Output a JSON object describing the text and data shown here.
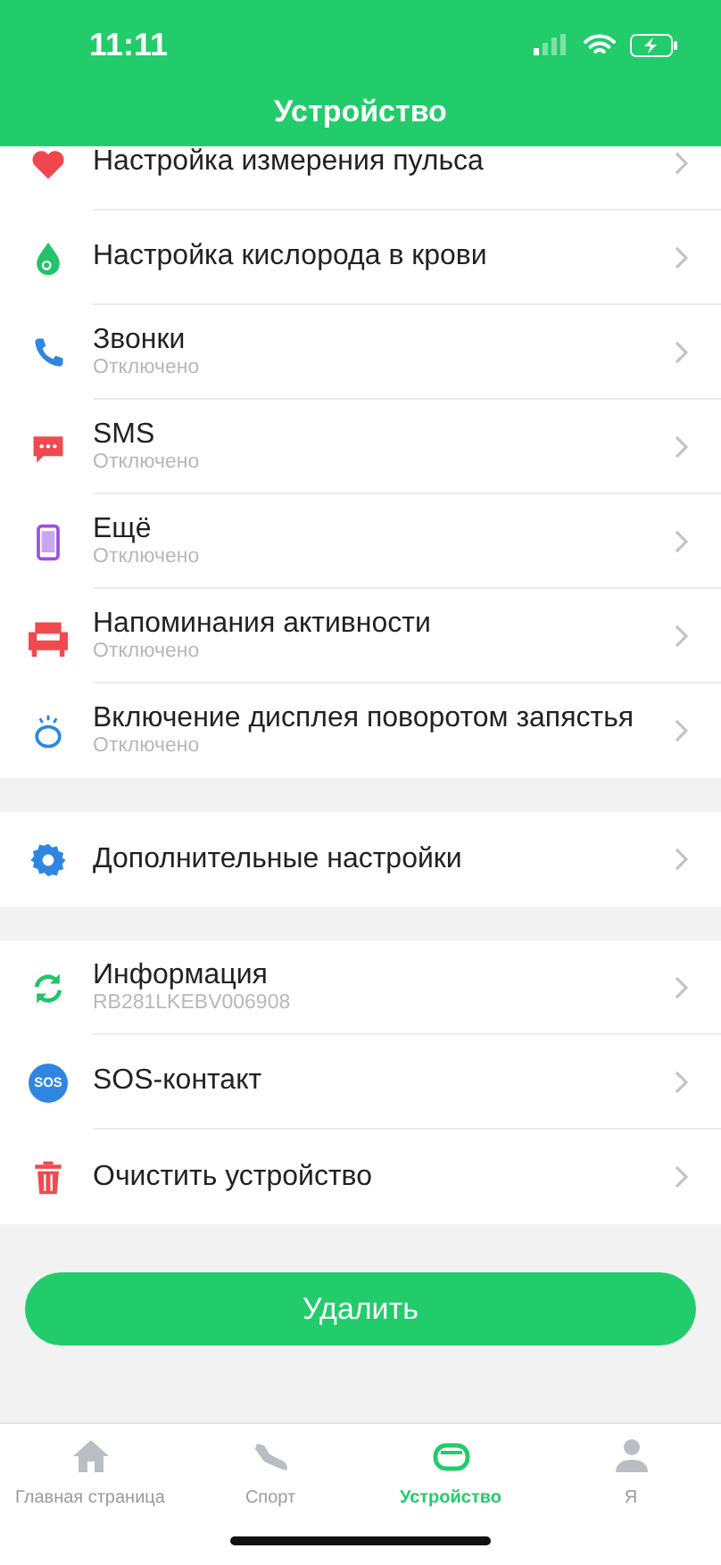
{
  "status_bar": {
    "time": "11:11"
  },
  "header": {
    "title": "Устройство"
  },
  "sections": [
    {
      "items": [
        {
          "title": "Настройка измерения пульса"
        },
        {
          "title": "Настройка кислорода в крови"
        },
        {
          "title": "Звонки",
          "subtitle": "Отключено"
        },
        {
          "title": "SMS",
          "subtitle": "Отключено"
        },
        {
          "title": "Ещё",
          "subtitle": "Отключено"
        },
        {
          "title": "Напоминания активности",
          "subtitle": "Отключено"
        },
        {
          "title": "Включение дисплея поворотом запястья",
          "subtitle": "Отключено"
        }
      ]
    },
    {
      "items": [
        {
          "title": "Дополнительные настройки"
        }
      ]
    },
    {
      "items": [
        {
          "title": "Информация",
          "subtitle": "RB281LKEBV006908"
        },
        {
          "title": "SOS-контакт",
          "icon_label": "SOS"
        },
        {
          "title": "Очистить устройство"
        }
      ]
    }
  ],
  "delete_button": "Удалить",
  "tab_bar": [
    {
      "label": "Главная страница",
      "selected": false
    },
    {
      "label": "Спорт",
      "selected": false
    },
    {
      "label": "Устройство",
      "selected": true
    },
    {
      "label": "Я",
      "selected": false
    }
  ]
}
